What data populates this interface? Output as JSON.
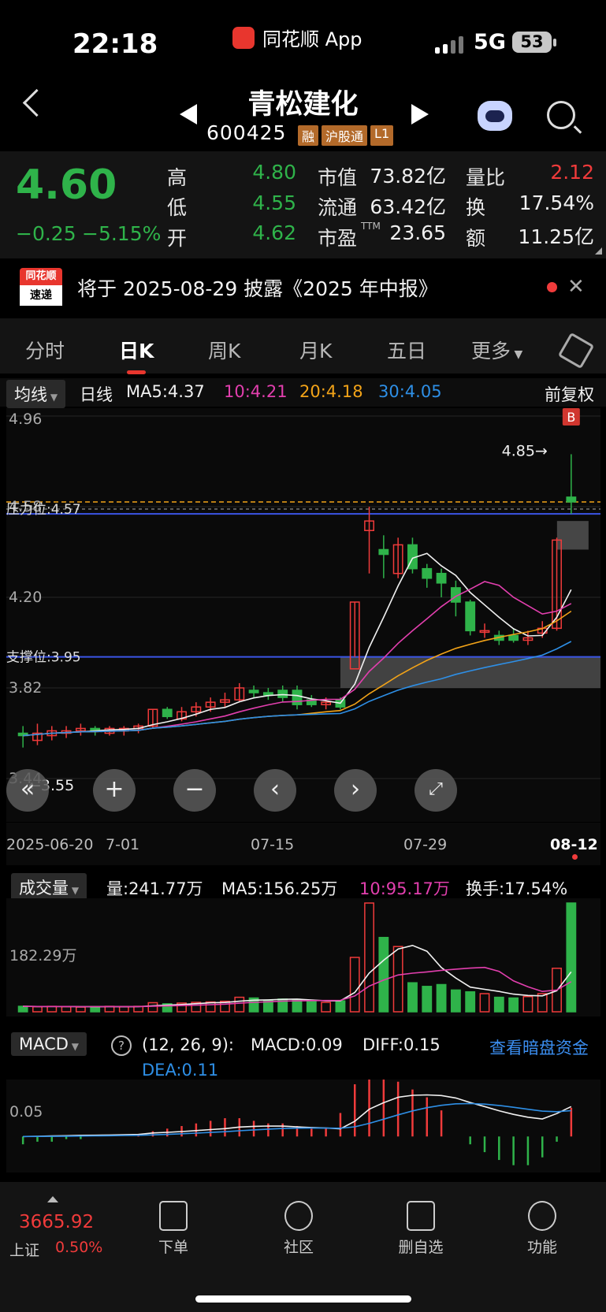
{
  "status_bar": {
    "time": "22:18",
    "app": "同花顺 App",
    "network": "5G",
    "battery": "53"
  },
  "header": {
    "stock_name": "青松建化",
    "stock_code": "600425",
    "tags": [
      "融",
      "沪股通",
      "L1"
    ]
  },
  "quote": {
    "price": "4.60",
    "change": "−0.25",
    "change_pct": "−5.15%",
    "high_label": "高",
    "high": "4.80",
    "low_label": "低",
    "low": "4.55",
    "open_label": "开",
    "open": "4.62",
    "mktcap_label": "市值",
    "mktcap": "73.82亿",
    "float_label": "流通",
    "float": "63.42亿",
    "pe_label": "市盈",
    "pe_sup": "TTM",
    "pe": "23.65",
    "volratio_label": "量比",
    "volratio": "2.12",
    "turnover_label": "换",
    "turnover": "17.54%",
    "amount_label": "额",
    "amount": "11.25亿"
  },
  "notice": {
    "badge_top": "同花顺",
    "badge_bottom": "速递",
    "text": "将于 2025-08-29 披露《2025 年中报》"
  },
  "tabs": [
    "分时",
    "日K",
    "周K",
    "月K",
    "五日",
    "更多"
  ],
  "active_tab": "日K",
  "ma_bar": {
    "selector": "均线",
    "period": "日线",
    "ma5": "MA5:4.37",
    "ma10": "10:4.21",
    "ma20": "20:4.18",
    "ma30": "30:4.05",
    "adjust": "前复权"
  },
  "kline": {
    "y_labels": [
      "4.96",
      "4.58",
      "4.20",
      "3.82",
      "3.44"
    ],
    "pressure": "压力位:4.57",
    "support": "支撑位:3.95",
    "max_marker": "4.85→",
    "min_marker": "←3.55",
    "buy_marker": "B",
    "dates": [
      "2025-06-20",
      "7-01",
      "07-15",
      "07-29",
      "08-12"
    ]
  },
  "colors": {
    "up": "#f03b3b",
    "down": "#2fb34a",
    "ma5": "#f0f0f0",
    "ma10": "#e23fae",
    "ma20": "#f2a318",
    "ma30": "#2e8fe6",
    "level": "#3b55e6"
  },
  "chart_data": [
    {
      "type": "candlestick",
      "x": [
        "2025-06-20",
        "06-23",
        "06-24",
        "06-25",
        "06-26",
        "06-27",
        "06-30",
        "07-01",
        "07-02",
        "07-03",
        "07-04",
        "07-07",
        "07-08",
        "07-09",
        "07-10",
        "07-11",
        "07-14",
        "07-15",
        "07-16",
        "07-17",
        "07-18",
        "07-21",
        "07-22",
        "07-23",
        "07-24",
        "07-25",
        "07-28",
        "07-29",
        "07-30",
        "07-31",
        "08-01",
        "08-04",
        "08-05",
        "08-06",
        "08-07",
        "08-08",
        "08-11",
        "08-12"
      ],
      "series": [
        {
          "values": [
            {
              "o": 3.63,
              "h": 3.66,
              "l": 3.57,
              "c": 3.62
            },
            {
              "o": 3.6,
              "h": 3.67,
              "l": 3.58,
              "c": 3.63
            },
            {
              "o": 3.62,
              "h": 3.66,
              "l": 3.6,
              "c": 3.64
            },
            {
              "o": 3.63,
              "h": 3.66,
              "l": 3.61,
              "c": 3.64
            },
            {
              "o": 3.64,
              "h": 3.67,
              "l": 3.62,
              "c": 3.65
            },
            {
              "o": 3.65,
              "h": 3.66,
              "l": 3.62,
              "c": 3.64
            },
            {
              "o": 3.63,
              "h": 3.66,
              "l": 3.62,
              "c": 3.65
            },
            {
              "o": 3.64,
              "h": 3.66,
              "l": 3.62,
              "c": 3.65
            },
            {
              "o": 3.65,
              "h": 3.67,
              "l": 3.63,
              "c": 3.66
            },
            {
              "o": 3.66,
              "h": 3.73,
              "l": 3.65,
              "c": 3.73
            },
            {
              "o": 3.73,
              "h": 3.74,
              "l": 3.69,
              "c": 3.7
            },
            {
              "o": 3.69,
              "h": 3.74,
              "l": 3.68,
              "c": 3.72
            },
            {
              "o": 3.72,
              "h": 3.76,
              "l": 3.7,
              "c": 3.74
            },
            {
              "o": 3.74,
              "h": 3.78,
              "l": 3.72,
              "c": 3.76
            },
            {
              "o": 3.76,
              "h": 3.8,
              "l": 3.74,
              "c": 3.77
            },
            {
              "o": 3.77,
              "h": 3.84,
              "l": 3.76,
              "c": 3.82
            },
            {
              "o": 3.81,
              "h": 3.83,
              "l": 3.78,
              "c": 3.8
            },
            {
              "o": 3.8,
              "h": 3.82,
              "l": 3.77,
              "c": 3.79
            },
            {
              "o": 3.81,
              "h": 3.83,
              "l": 3.76,
              "c": 3.78
            },
            {
              "o": 3.81,
              "h": 3.83,
              "l": 3.73,
              "c": 3.75
            },
            {
              "o": 3.77,
              "h": 3.79,
              "l": 3.74,
              "c": 3.75
            },
            {
              "o": 3.75,
              "h": 3.78,
              "l": 3.73,
              "c": 3.76
            },
            {
              "o": 3.77,
              "h": 3.78,
              "l": 3.73,
              "c": 3.74
            },
            {
              "o": 3.9,
              "h": 4.18,
              "l": 3.95,
              "c": 4.18
            },
            {
              "o": 4.48,
              "h": 4.58,
              "l": 4.3,
              "c": 4.52
            },
            {
              "o": 4.4,
              "h": 4.46,
              "l": 4.28,
              "c": 4.38
            },
            {
              "o": 4.3,
              "h": 4.45,
              "l": 4.28,
              "c": 4.42
            },
            {
              "o": 4.42,
              "h": 4.45,
              "l": 4.3,
              "c": 4.32
            },
            {
              "o": 4.32,
              "h": 4.34,
              "l": 4.24,
              "c": 4.28
            },
            {
              "o": 4.3,
              "h": 4.32,
              "l": 4.2,
              "c": 4.26
            },
            {
              "o": 4.24,
              "h": 4.27,
              "l": 4.12,
              "c": 4.18
            },
            {
              "o": 4.18,
              "h": 4.19,
              "l": 4.04,
              "c": 4.06
            },
            {
              "o": 4.06,
              "h": 4.09,
              "l": 4.03,
              "c": 4.06
            },
            {
              "o": 4.04,
              "h": 4.06,
              "l": 4.0,
              "c": 4.02
            },
            {
              "o": 4.04,
              "h": 4.07,
              "l": 4.01,
              "c": 4.02
            },
            {
              "o": 4.02,
              "h": 4.06,
              "l": 4.0,
              "c": 4.03
            },
            {
              "o": 4.05,
              "h": 4.1,
              "l": 4.03,
              "c": 4.07
            },
            {
              "o": 4.07,
              "h": 4.45,
              "l": 4.06,
              "c": 4.44
            },
            {
              "o": 4.62,
              "h": 4.8,
              "l": 4.55,
              "c": 4.6
            }
          ]
        }
      ],
      "ylim": [
        3.44,
        4.96
      ]
    },
    {
      "type": "bar",
      "title": "成交量",
      "values": [
        15,
        14,
        15,
        14,
        13,
        14,
        15,
        14,
        15,
        25,
        22,
        24,
        26,
        27,
        29,
        40,
        38,
        30,
        35,
        32,
        28,
        26,
        30,
        150,
        300,
        205,
        180,
        80,
        70,
        75,
        60,
        55,
        50,
        40,
        38,
        42,
        50,
        120,
        300
      ],
      "ylim": [
        0,
        300
      ]
    },
    {
      "type": "bar",
      "title": "MACD",
      "values": [
        -0.03,
        -0.02,
        -0.02,
        -0.01,
        -0.01,
        0,
        0,
        0,
        0.01,
        0.02,
        0.03,
        0.04,
        0.05,
        0.06,
        0.07,
        0.07,
        0.06,
        0.05,
        0.05,
        0.04,
        0.03,
        0.03,
        0.09,
        0.2,
        0.24,
        0.22,
        0.21,
        0.18,
        0.15,
        0.1,
        0,
        -0.03,
        -0.06,
        -0.09,
        -0.11,
        -0.11,
        -0.08,
        -0.02,
        0.11
      ],
      "ylim": [
        -0.12,
        0.2
      ]
    }
  ],
  "volume_bar": {
    "selector": "成交量",
    "vol": "量:241.77万",
    "ma5": "MA5:156.25万",
    "ma10": "10:95.17万",
    "turnover": "换手:17.54%",
    "y_label": "182.29万"
  },
  "macd_bar": {
    "selector": "MACD",
    "help": "?",
    "params": "(12, 26, 9):",
    "macd": "MACD:0.09",
    "diff": "DIFF:0.15",
    "link": "查看暗盘资金",
    "dea": "DEA:0.11",
    "y_label": "0.05"
  },
  "bottom_nav": {
    "index_value": "3665.92",
    "index_name": "上证",
    "index_pct": "0.50%",
    "items": [
      "下单",
      "社区",
      "删自选",
      "功能"
    ]
  }
}
